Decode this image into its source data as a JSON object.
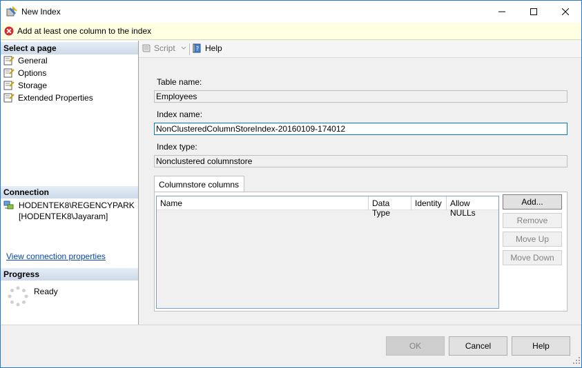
{
  "window": {
    "title": "New Index"
  },
  "error": {
    "message": "Add at least one column to the index"
  },
  "left": {
    "select_page_header": "Select a page",
    "pages": [
      {
        "label": "General",
        "icon": "page-wrench-icon"
      },
      {
        "label": "Options",
        "icon": "page-wrench-icon"
      },
      {
        "label": "Storage",
        "icon": "page-wrench-icon"
      },
      {
        "label": "Extended Properties",
        "icon": "page-wrench-icon"
      }
    ],
    "connection_header": "Connection",
    "connection_line1": "HODENTEK8\\REGENCYPARK",
    "connection_line2": "[HODENTEK8\\Jayaram]",
    "view_connection_link": "View connection properties",
    "progress_header": "Progress",
    "progress_status": "Ready"
  },
  "toolbar": {
    "script_label": "Script",
    "help_label": "Help"
  },
  "form": {
    "table_name_label": "Table name:",
    "table_name_value": "Employees",
    "index_name_label": "Index name:",
    "index_name_value": "NonClusteredColumnStoreIndex-20160109-174012",
    "index_type_label": "Index type:",
    "index_type_value": "Nonclustered columnstore"
  },
  "columns_tab": {
    "tab_label": "Columnstore columns",
    "headers": [
      "Name",
      "Data Type",
      "Identity",
      "Allow NULLs"
    ],
    "buttons": {
      "add": "Add...",
      "remove": "Remove",
      "move_up": "Move Up",
      "move_down": "Move Down"
    }
  },
  "dialog": {
    "ok": "OK",
    "cancel": "Cancel",
    "help": "Help"
  },
  "colors": {
    "error_bar": "#ffffe1",
    "link": "#0645ad",
    "section_header": "#ccd9e8"
  }
}
